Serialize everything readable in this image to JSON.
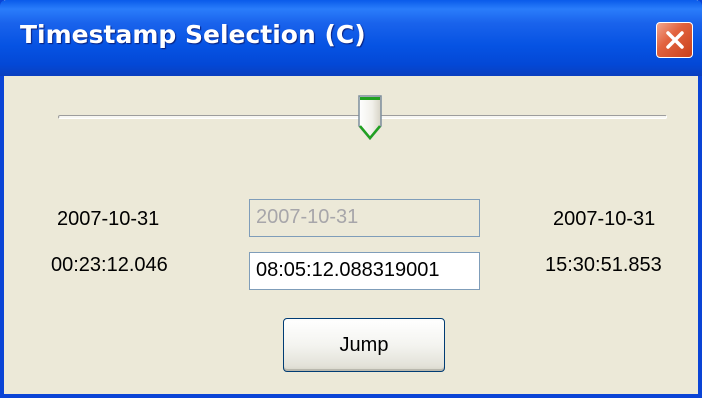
{
  "window": {
    "title": "Timestamp Selection (C)"
  },
  "slider": {
    "position": 0.5
  },
  "start": {
    "date": "2007-10-31",
    "time": "00:23:12.046"
  },
  "current": {
    "date": "2007-10-31",
    "time": "08:05:12.088319001"
  },
  "end": {
    "date": "2007-10-31",
    "time": "15:30:51.853"
  },
  "buttons": {
    "jump_label": "Jump"
  },
  "icons": {
    "close": "close-icon",
    "slider_thumb": "slider-thumb-icon"
  },
  "colors": {
    "titlebar": "#0653e3",
    "window_bg": "#ece9d8",
    "close_button": "#e2633f",
    "thumb_accent": "#21a121"
  }
}
